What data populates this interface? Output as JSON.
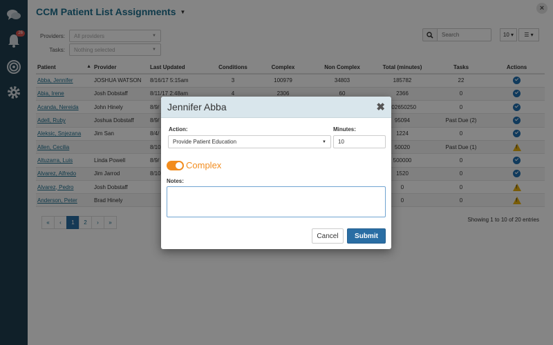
{
  "sidebar": {
    "notification_count": "26"
  },
  "header": {
    "title": "CCM Patient List Assignments"
  },
  "filters": {
    "providers_label": "Providers:",
    "providers_placeholder": "All providers",
    "tasks_label": "Tasks:",
    "tasks_placeholder": "Nothing selected"
  },
  "search": {
    "placeholder": "Search"
  },
  "page_size": "10",
  "table": {
    "columns": [
      "Patient",
      "Provider",
      "Last Updated",
      "Conditions",
      "Complex",
      "Non Complex",
      "Total (minutes)",
      "Tasks",
      "Actions"
    ],
    "rows": [
      {
        "patient": "Abba, Jennifer",
        "provider": "JOSHUA WATSON",
        "updated": "8/16/17 5:15am",
        "conditions": "3",
        "complex": "100979",
        "noncomplex": "34803",
        "total": "185782",
        "tasks": "22",
        "action": "check"
      },
      {
        "patient": "Abia, Irene",
        "provider": "Josh Dobstaff",
        "updated": "8/11/17 2:48am",
        "conditions": "4",
        "complex": "2306",
        "noncomplex": "60",
        "total": "2366",
        "tasks": "0",
        "action": "check"
      },
      {
        "patient": "Acanda, Nereida",
        "provider": "John Hinely",
        "updated": "8/9/",
        "conditions": "",
        "complex": "",
        "noncomplex": "",
        "total": "202650250",
        "tasks": "0",
        "action": "check"
      },
      {
        "patient": "Adell, Ruby",
        "provider": "Joshua Dobstaff",
        "updated": "8/9/",
        "conditions": "",
        "complex": "",
        "noncomplex": "",
        "total": "95094",
        "tasks": "Past Due (2)",
        "action": "check"
      },
      {
        "patient": "Aleksic, Snjezana",
        "provider": "Jim San",
        "updated": "8/4/",
        "conditions": "",
        "complex": "",
        "noncomplex": "",
        "total": "1224",
        "tasks": "0",
        "action": "check"
      },
      {
        "patient": "Allen, Cecilia",
        "provider": "",
        "updated": "8/10",
        "conditions": "",
        "complex": "",
        "noncomplex": "",
        "total": "50020",
        "tasks": "Past Due (1)",
        "action": "warn"
      },
      {
        "patient": "Altuzarra, Luis",
        "provider": "Linda Powell",
        "updated": "8/9/",
        "conditions": "",
        "complex": "",
        "noncomplex": "",
        "total": "500000",
        "tasks": "0",
        "action": "check"
      },
      {
        "patient": "Alvarez, Alfredo",
        "provider": "Jim Jarrod",
        "updated": "8/10",
        "conditions": "",
        "complex": "",
        "noncomplex": "",
        "total": "1520",
        "tasks": "0",
        "action": "check"
      },
      {
        "patient": "Alvarez, Pedro",
        "provider": "Josh Dobstaff",
        "updated": "",
        "conditions": "",
        "complex": "",
        "noncomplex": "",
        "total": "0",
        "tasks": "0",
        "action": "warn"
      },
      {
        "patient": "Anderson, Peter",
        "provider": "Brad Hinely",
        "updated": "",
        "conditions": "",
        "complex": "",
        "noncomplex": "",
        "total": "0",
        "tasks": "0",
        "action": "warn"
      }
    ]
  },
  "pagination": {
    "first": "«",
    "prev": "‹",
    "pages": [
      "1",
      "2"
    ],
    "next": "›",
    "last": "»",
    "summary": "Showing 1 to 10 of 20 entries"
  },
  "modal": {
    "title": "Jennifer Abba",
    "close": "✖",
    "action_label": "Action:",
    "action_value": "Provide Patient Education",
    "minutes_label": "Minutes:",
    "minutes_value": "10",
    "complex_label": "Complex",
    "complex_on": true,
    "notes_label": "Notes:",
    "cancel_label": "Cancel",
    "submit_label": "Submit"
  },
  "colors": {
    "sidebar": "#1f3f4f",
    "title": "#1d6f8f",
    "complex": "#e8941a",
    "noncomplex": "#1d7fa8",
    "past_due": "#c9302c",
    "primary": "#2a6ea4",
    "toggle": "#f28c1e"
  }
}
